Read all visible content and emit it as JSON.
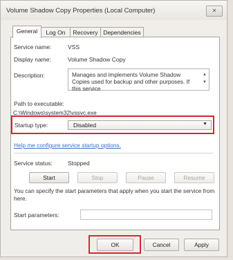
{
  "window": {
    "title": "Volume Shadow Copy Properties (Local Computer)",
    "close_label": "✕"
  },
  "tabs": [
    {
      "label": "General"
    },
    {
      "label": "Log On"
    },
    {
      "label": "Recovery"
    },
    {
      "label": "Dependencies"
    }
  ],
  "general": {
    "service_name_label": "Service name:",
    "service_name_value": "VSS",
    "display_name_label": "Display name:",
    "display_name_value": "Volume Shadow Copy",
    "description_label": "Description:",
    "description_value": "Manages and implements Volume Shadow Copies used for backup and other purposes. If this service",
    "path_label": "Path to executable:",
    "path_value": "C:\\Windows\\system32\\vssvc.exe",
    "startup_type_label": "Startup type:",
    "startup_type_value": "Disabled",
    "help_link": "Help me configure service startup options.",
    "status_label": "Service status:",
    "status_value": "Stopped",
    "buttons": {
      "start": "Start",
      "stop": "Stop",
      "pause": "Pause",
      "resume": "Resume"
    },
    "info_text": "You can specify the start parameters that apply when you start the service from here.",
    "start_params_label": "Start parameters:",
    "start_params_value": ""
  },
  "footer": {
    "ok": "OK",
    "cancel": "Cancel",
    "apply": "Apply"
  },
  "colors": {
    "highlight": "#d9262d",
    "link": "#3b6ec8"
  }
}
